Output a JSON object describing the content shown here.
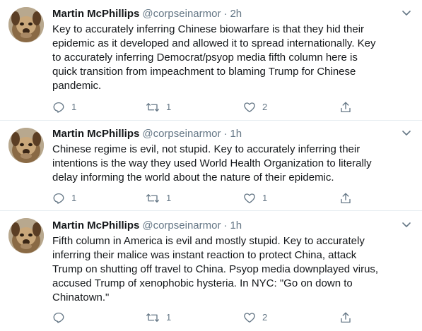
{
  "tweets": [
    {
      "name": "Martin McPhillips",
      "handle": "@corpseinarmor",
      "separator": "·",
      "time": "2h",
      "lines": [
        "Key to accurately inferring Chinese biowarfare is that they hid their",
        "epidemic as it developed and allowed it to spread internationally. Key",
        "to accurately inferring Democrat/psyop media fifth column here is",
        "quick transition from impeachment to blaming Trump for Chinese",
        "pandemic."
      ],
      "replies": "1",
      "retweets": "1",
      "likes": "2"
    },
    {
      "name": "Martin McPhillips",
      "handle": "@corpseinarmor",
      "separator": "·",
      "time": "1h",
      "lines": [
        "Chinese regime is evil, not stupid. Key to accurately inferring their",
        "intentions is the way they used World Health Organization to literally",
        "delay informing the world about the nature of their epidemic."
      ],
      "replies": "1",
      "retweets": "1",
      "likes": "1"
    },
    {
      "name": "Martin McPhillips",
      "handle": "@corpseinarmor",
      "separator": "·",
      "time": "1h",
      "lines": [
        "Fifth column in America is evil and mostly stupid. Key to accurately",
        "inferring their malice was instant reaction to protect China, attack",
        "Trump on shutting off travel to China. Psyop media downplayed virus,",
        "accused Trump of xenophobic hysteria. In NYC: \"Go on down to",
        "Chinatown.\""
      ],
      "replies": "",
      "retweets": "1",
      "likes": "2"
    }
  ],
  "colors": {
    "text": "#14171a",
    "secondary": "#657786",
    "divider": "#e6ecf0",
    "icon": "#657786"
  },
  "icons": {
    "reply": "reply-icon",
    "retweet": "retweet-icon",
    "like": "heart-icon",
    "share": "share-icon",
    "more": "chevron-down-icon"
  }
}
